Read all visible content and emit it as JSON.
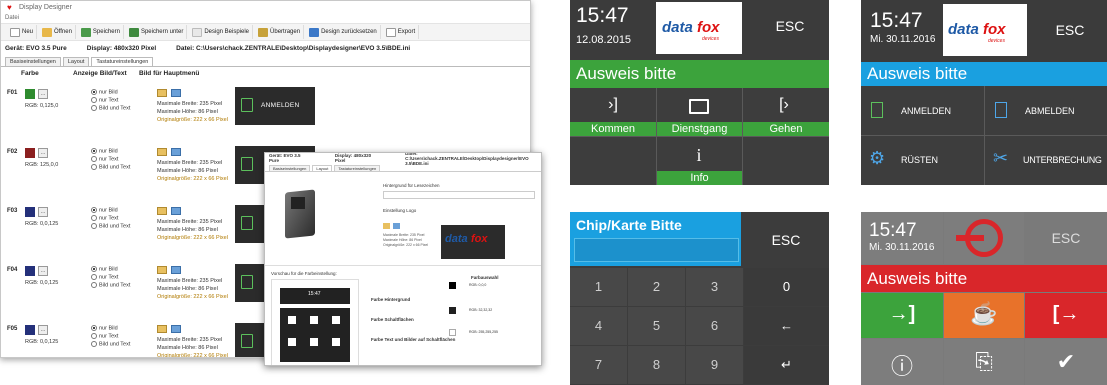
{
  "designer": {
    "title": "Display Designer",
    "menu": "Datei",
    "toolbar": [
      "Neu",
      "Öffnen",
      "Speichern",
      "Speichern unter",
      "Design Beispiele",
      "Übertragen",
      "Design zurücksetzen",
      "Export"
    ],
    "info": {
      "device": "Gerät: EVO 3.5 Pure",
      "display": "Display: 480x320 Pixel",
      "file": "Datei: C:\\Users\\chack.ZENTRALE\\Desktop\\Displaydesigner\\EVO 3.5\\BDE.ini"
    },
    "tabs": [
      "Basiseinstellungen",
      "Layout",
      "Tastatureinstellungen"
    ],
    "columns": [
      "Farbe",
      "Anzeige Bild/Text",
      "Bild für Hauptmenü"
    ],
    "radio_options": [
      "nur Bild",
      "nur Text",
      "Bild und Text"
    ],
    "info_lines": [
      "Maximale Breite: 235 Pixel",
      "Maximale Höhe: 86 Pixel",
      "Originalgröße: 222 x 66 Pixel"
    ],
    "rows": [
      {
        "key": "F01",
        "rgb": "RGB: 0,125,0",
        "swatch": "#2e8b2e",
        "tile_label": "ANMELDEN"
      },
      {
        "key": "F02",
        "rgb": "RGB: 125,0,0",
        "swatch": "#8b1f1f",
        "tile_label": ""
      },
      {
        "key": "F03",
        "rgb": "RGB: 0,0,125",
        "swatch": "#24307a",
        "tile_label": ""
      },
      {
        "key": "F04",
        "rgb": "RGB: 0,0,125",
        "swatch": "#24307a",
        "tile_label": ""
      },
      {
        "key": "F05",
        "rgb": "RGB: 0,0,125",
        "swatch": "#24307a",
        "tile_label": ""
      }
    ]
  },
  "dialog": {
    "header": [
      "Gerät: EVO 3.5 Pure",
      "Display: 480x320 Pixel",
      "Datei: C:\\Users\\chack.ZENTRALE\\Desktop\\Displaydesigner\\EVO 3.5\\BDE.ini"
    ],
    "tabs": [
      "Basiseinstellungen",
      "Layout",
      "Tastatureinstellungen"
    ],
    "logo_section": "Einstellung Logo",
    "bg_section": "Hintergrund für Lesezeichen",
    "preview_section": "Vorschau für die Farbeinstellung:",
    "color_labels": [
      "Farbe Hintergrund",
      "Farbe Schaltflächen",
      "Farbe Text und Bilder auf Schaltflächen"
    ],
    "color_values": [
      "RGB: 0,0,0",
      "RGB: 32,32,32",
      "RGB: 255,255,255"
    ],
    "choose_label": "Farbauswahl",
    "preview_time": "15:47"
  },
  "screen1": {
    "time": "15:47",
    "date": "12.08.2015",
    "brand": "datafox",
    "brand_sub": "devices",
    "esc": "ESC",
    "prompt": "Ausweis bitte",
    "buttons": [
      {
        "label": "Kommen",
        "icon": "enter-icon"
      },
      {
        "label": "Dienstgang",
        "icon": "briefcase-icon"
      },
      {
        "label": "Gehen",
        "icon": "exit-icon"
      },
      {
        "label": "",
        "icon": ""
      },
      {
        "label": "Info",
        "icon": "info-icon"
      },
      {
        "label": "",
        "icon": ""
      }
    ]
  },
  "screen2": {
    "time": "15:47",
    "date": "Mi. 30.11.2016",
    "brand": "datafox",
    "brand_sub": "devices",
    "esc": "ESC",
    "prompt": "Ausweis bitte",
    "buttons": [
      {
        "label": "ANMELDEN",
        "icon": "login-document-icon"
      },
      {
        "label": "ABMELDEN",
        "icon": "logout-document-icon"
      },
      {
        "label": "RÜSTEN",
        "icon": "gear-icon"
      },
      {
        "label": "UNTERBRECHUNG",
        "icon": "wrench-icon"
      }
    ]
  },
  "screen3": {
    "title": "Chip/Karte Bitte",
    "esc": "ESC",
    "keys": [
      "1",
      "2",
      "3",
      "0",
      "4",
      "5",
      "6",
      "←",
      "7",
      "8",
      "9",
      "↵"
    ]
  },
  "screen4": {
    "time": "15:47",
    "date": "Mi. 30.11.2016",
    "esc": "ESC",
    "prompt": "Ausweis bitte",
    "buttons": [
      {
        "icon": "enter-icon",
        "glyph": "→]"
      },
      {
        "icon": "coffee-icon",
        "glyph": "☕"
      },
      {
        "icon": "exit-icon",
        "glyph": "[→"
      },
      {
        "icon": "info-icon",
        "glyph": "ⓘ"
      },
      {
        "icon": "documents-icon",
        "glyph": "⎘"
      },
      {
        "icon": "check-icon",
        "glyph": "✔"
      }
    ]
  },
  "colors": {
    "green": "#3ca33c",
    "blue": "#1aa0e0",
    "red": "#d9262a",
    "orange": "#e8722a",
    "gray": "#7d7d7d",
    "dark": "#3a3a3a"
  }
}
